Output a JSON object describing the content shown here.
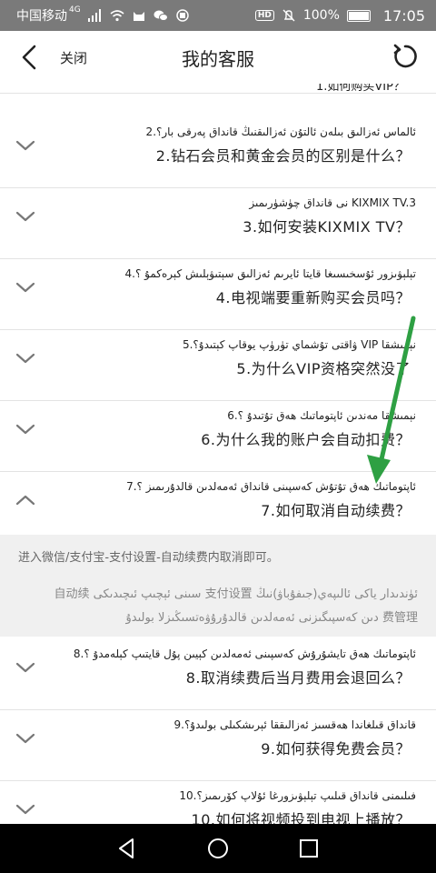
{
  "status_bar": {
    "carrier": "中国移动",
    "network": "4G",
    "hd": "HD",
    "battery": "100%",
    "time": "17:05"
  },
  "header": {
    "close_label": "关闭",
    "title": "我的客服"
  },
  "partial_item": "1.如何购买VIP？",
  "faq": [
    {
      "ug": "ئالماس ئەزالىق بىلەن ئالتۇن ئەزالىقنىڭ قانداق پەرقى بار؟.2",
      "cn": "2.钻石会员和黄金会员的区别是什么？"
    },
    {
      "ug": "KIXMIX TV.3 نى قانداق چۈشۈرىمىز",
      "cn": "3.如何安装KIXMIX TV？"
    },
    {
      "ug": "تېلېۋىزور ئۇسخىسىغا قايتا ئايرىم ئەزالىق سېتىۋېلىش كېرەكمۇ ؟.4",
      "cn": "4.电视端要重新购买会员吗？"
    },
    {
      "ug": "نېمىشقا VIP ۋاقتى تۇشماي تۈرۈپ يوقاپ كېتىدۇ؟.5",
      "cn": "5.为什么VIP资格突然没了"
    },
    {
      "ug": "نېمىشقا مەندىن ئاپتوماتىك ھەق تۇتىدۇ ؟.6",
      "cn": "6.为什么我的账户会自动扣费？"
    },
    {
      "ug": "ئاپتوماتىك ھەق تۇتۇش كەسپىنى قانداق ئەمەلدىن قالدۇرىمىز ؟.7",
      "cn": "7.如何取消自动续费？"
    },
    {
      "ug": "ئاپتوماتىك ھەق تايشۇرۇش كەسپىنى ئەمەلدىن كېيىن پۇل قايتىپ كېلەمدۇ ؟.8",
      "cn": "8.取消续费后当月费用会退回么？"
    },
    {
      "ug": "قانداق قىلغاندا ھەقسىز ئەزالىققا ئېرىشكىلى بولىدۇ؟.9",
      "cn": "9.如何获得免费会员？"
    },
    {
      "ug": "فىلىمنى قانداق قىلىپ تېلېۋىزورغا ئۇلاپ كۆرىمىز؟.10",
      "cn": "10.如何将视频投到电视上播放？"
    }
  ],
  "answer": {
    "cn": "进入微信/支付宝-支付设置-自动续费内取消即可。",
    "ug_line1": "ئۈندىدار ياكى ئالىپەي(جىفۇباۋ)نىڭ 支付设置 سىنى ئېچىپ ئىچىدىكى 自动续",
    "ug_line2": "费管理 دىن كەسپىگىزنى ئەمەلدىن قالدۇرۇۋەتسىڭىزلا بولىدۇ"
  },
  "colors": {
    "status_bar": "#7a7a7a",
    "answer_bg": "#f0f0f0",
    "arrow": "#2ea043",
    "nav_bar": "#000000"
  }
}
